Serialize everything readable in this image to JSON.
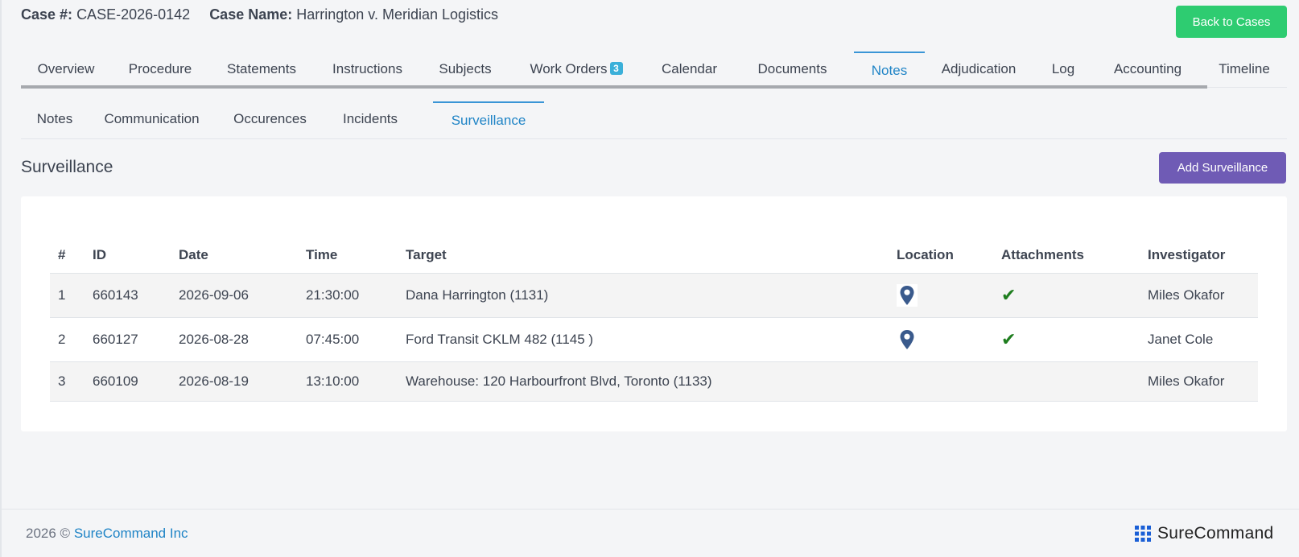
{
  "header": {
    "case_number_label": "Case #:",
    "case_number": "CASE-2026-0142",
    "case_name_label": "Case Name:",
    "case_name": "Harrington v. Meridian Logistics",
    "back_button": "Back to Cases",
    "back_button_color": "#2ecc71"
  },
  "main_tabs": [
    {
      "label": "Overview"
    },
    {
      "label": "Procedure"
    },
    {
      "label": "Statements"
    },
    {
      "label": "Instructions"
    },
    {
      "label": "Subjects"
    },
    {
      "label": "Work Orders",
      "badge": "3"
    },
    {
      "label": "Calendar"
    },
    {
      "label": "Documents"
    },
    {
      "label": "Notes",
      "active": true
    },
    {
      "label": "Adjudication"
    },
    {
      "label": "Log"
    },
    {
      "label": "Accounting"
    },
    {
      "label": "Timeline"
    }
  ],
  "sub_tabs": [
    {
      "label": "Notes"
    },
    {
      "label": "Communication"
    },
    {
      "label": "Occurences"
    },
    {
      "label": "Incidents"
    },
    {
      "label": "Surveillance",
      "active": true
    }
  ],
  "section": {
    "title": "Surveillance",
    "add_button": "Add Surveillance",
    "add_button_color": "#6f5bb5"
  },
  "table": {
    "headers": [
      "#",
      "ID",
      "Date",
      "Time",
      "Target",
      "Location",
      "Attachments",
      "Investigator"
    ],
    "rows": [
      {
        "num": "1",
        "id": "660143",
        "date": "2026-09-06",
        "time": "21:30:00",
        "target": "Dana Harrington (1131)",
        "location_icon": "map-pin-icon",
        "attachment_icon": "checkmark-icon",
        "investigator": "Miles Okafor"
      },
      {
        "num": "2",
        "id": "660127",
        "date": "2026-08-28",
        "time": "07:45:00",
        "target": "Ford Transit CKLM 482 (1145 )",
        "location_icon": "map-pin-icon",
        "attachment_icon": "checkmark-icon",
        "investigator": "Janet Cole"
      },
      {
        "num": "3",
        "id": "660109",
        "date": "2026-08-19",
        "time": "13:10:00",
        "target": "Warehouse: 120 Harbourfront Blvd, Toronto (1133)",
        "investigator": "Miles Okafor"
      }
    ]
  },
  "footer": {
    "copyright": "2026 ©",
    "company_link": "SureCommand Inc",
    "brand": "SureCommand",
    "brand_icon": "grid-dots-icon"
  },
  "colors": {
    "link": "#1f84c6",
    "badge": "#3bb0d9",
    "pin": "#3a5a8c",
    "check": "#1e7d1e"
  }
}
